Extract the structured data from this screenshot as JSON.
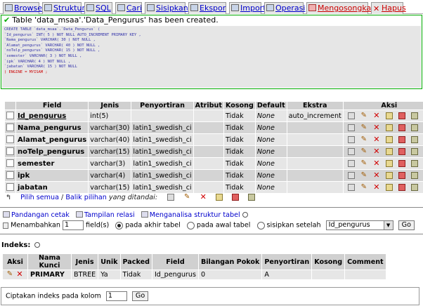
{
  "tabs": [
    {
      "label": "Browse",
      "icon": "browse-icon"
    },
    {
      "label": "Struktur",
      "icon": "structure-icon"
    },
    {
      "label": "SQL",
      "icon": "sql-icon"
    },
    {
      "label": "Cari",
      "icon": "search-icon"
    },
    {
      "label": "Sisipkan",
      "icon": "insert-icon"
    },
    {
      "label": "Ekspor",
      "icon": "export-icon"
    },
    {
      "label": "Import",
      "icon": "import-icon"
    },
    {
      "label": "Operasi",
      "icon": "operations-icon"
    },
    {
      "label": "Mengosongkan",
      "icon": "empty-icon"
    },
    {
      "label": "Hapus",
      "icon": "drop-icon"
    }
  ],
  "message": {
    "text": "Table 'data_msaa'.'Data_Pengurus' has been created.",
    "sql_lines": [
      "CREATE TABLE `data_msaa`.`Data_Pengurus` (",
      "`Id_pengurus` INT( 5 ) NOT NULL AUTO_INCREMENT PRIMARY KEY ,",
      "`Nama_pengurus` VARCHAR( 30 ) NOT NULL ,",
      "`Alamat_pengurus` VARCHAR( 40 ) NOT NULL ,",
      "`noTelp_pengurus` VARCHAR( 15 ) NOT NULL ,",
      "`semester` VARCHAR( 3 ) NOT NULL ,",
      "`ipk` VARCHAR( 4 ) NOT NULL ,",
      "`jabatan` VARCHAR( 15 ) NOT NULL",
      ") ENGINE = MYISAM ;"
    ]
  },
  "structure": {
    "headers": [
      "Field",
      "Jenis",
      "Penyortiran",
      "Atribut",
      "Kosong",
      "Default",
      "Ekstra",
      "Aksi"
    ],
    "rows": [
      {
        "field": "Id_pengurus",
        "type": "int(5)",
        "collation": "",
        "attr": "",
        "null": "Tidak",
        "default": "None",
        "extra": "auto_increment"
      },
      {
        "field": "Nama_pengurus",
        "type": "varchar(30)",
        "collation": "latin1_swedish_ci",
        "attr": "",
        "null": "Tidak",
        "default": "None",
        "extra": ""
      },
      {
        "field": "Alamat_pengurus",
        "type": "varchar(40)",
        "collation": "latin1_swedish_ci",
        "attr": "",
        "null": "Tidak",
        "default": "None",
        "extra": ""
      },
      {
        "field": "noTelp_pengurus",
        "type": "varchar(15)",
        "collation": "latin1_swedish_ci",
        "attr": "",
        "null": "Tidak",
        "default": "None",
        "extra": ""
      },
      {
        "field": "semester",
        "type": "varchar(3)",
        "collation": "latin1_swedish_ci",
        "attr": "",
        "null": "Tidak",
        "default": "None",
        "extra": ""
      },
      {
        "field": "ipk",
        "type": "varchar(4)",
        "collation": "latin1_swedish_ci",
        "attr": "",
        "null": "Tidak",
        "default": "None",
        "extra": ""
      },
      {
        "field": "jabatan",
        "type": "varchar(15)",
        "collation": "latin1_swedish_ci",
        "attr": "",
        "null": "Tidak",
        "default": "None",
        "extra": ""
      }
    ],
    "select_all": "Pilih semua",
    "unselect_all": "Balik pilihan",
    "with_selected": "yang ditandai:"
  },
  "links": {
    "print_view": "Pandangan cetak",
    "relation_view": "Tampilan relasi",
    "analyze": "Menganalisa struktur tabel"
  },
  "add_field": {
    "label": "Menambahkan",
    "count": "1",
    "fields_label": "field(s)",
    "opt_end": "pada akhir tabel",
    "opt_begin": "pada awal tabel",
    "opt_after": "sisipkan setelah",
    "after_value": "Id_pengurus",
    "go": "Go"
  },
  "indexes": {
    "title": "Indeks:",
    "headers": [
      "Aksi",
      "Nama Kunci",
      "Jenis",
      "Unik",
      "Packed",
      "Field",
      "Bilangan Pokok",
      "Penyortiran",
      "Kosong",
      "Comment"
    ],
    "rows": [
      {
        "name": "PRIMARY",
        "type": "BTREE",
        "unique": "Ya",
        "packed": "Tidak",
        "field": "Id_pengurus",
        "cardinality": "0",
        "collation": "A",
        "null": "",
        "comment": ""
      }
    ]
  },
  "create_index": {
    "label": "Ciptakan indeks pada kolom",
    "value": "1",
    "go": "Go"
  }
}
